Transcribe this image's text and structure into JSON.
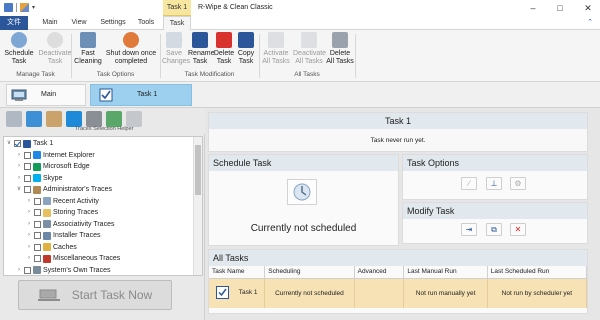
{
  "window": {
    "title": "R-Wipe & Clean Classic",
    "context_group": "Task 1",
    "controls": {
      "minimize": "–",
      "maximize": "□",
      "close": "✕"
    }
  },
  "tabs": [
    "文件",
    "Main",
    "View",
    "Settings",
    "Tools",
    "Task"
  ],
  "ribbon": {
    "buttons": [
      {
        "label1": "Schedule",
        "label2": "Task",
        "icon": "clock-icon",
        "disabled": false
      },
      {
        "label1": "Deactivate",
        "label2": "Task",
        "icon": "clock-off-icon",
        "disabled": true
      },
      {
        "label1": "Fast",
        "label2": "Cleaning",
        "icon": "broom-icon",
        "disabled": false
      },
      {
        "label1": "Shut down once",
        "label2": "completed",
        "icon": "power-icon",
        "disabled": false
      },
      {
        "label1": "Save",
        "label2": "Changes",
        "icon": "save-icon",
        "disabled": true
      },
      {
        "label1": "Rename",
        "label2": "Task",
        "icon": "rename-icon",
        "disabled": false
      },
      {
        "label1": "Delete",
        "label2": "Task",
        "icon": "delete-icon",
        "disabled": false
      },
      {
        "label1": "Copy",
        "label2": "Task",
        "icon": "copy-icon",
        "disabled": false
      },
      {
        "label1": "Activate",
        "label2": "All Tasks",
        "icon": "clipboard-icon",
        "disabled": true
      },
      {
        "label1": "Deactivate",
        "label2": "All Tasks",
        "icon": "clipboard-icon",
        "disabled": true
      },
      {
        "label1": "Delete",
        "label2": "All Tasks",
        "icon": "clipboard-delete-icon",
        "disabled": false
      }
    ],
    "groups": [
      "Manage Task",
      "Task Options",
      "Task Modification",
      "All Tasks"
    ]
  },
  "modebar": {
    "main_label": "Main",
    "task_label": "Task 1"
  },
  "left": {
    "helper_label": "Traces Selection Helper",
    "tree": [
      {
        "label": "Task 1",
        "level": 0,
        "expanded": true,
        "checked": true,
        "icon": "task-icon"
      },
      {
        "label": "Internet  Explorer",
        "level": 1,
        "expanded": false,
        "checked": false,
        "icon": "ie-icon"
      },
      {
        "label": "Microsoft Edge",
        "level": 1,
        "expanded": false,
        "checked": false,
        "icon": "edge-icon"
      },
      {
        "label": "Skype",
        "level": 1,
        "expanded": false,
        "checked": false,
        "icon": "skype-icon"
      },
      {
        "label": "Administrator's Traces",
        "level": 1,
        "expanded": true,
        "checked": false,
        "icon": "user-icon"
      },
      {
        "label": "Recent Activity",
        "level": 2,
        "expanded": false,
        "checked": false,
        "icon": "clock-icon"
      },
      {
        "label": "Storing Traces",
        "level": 2,
        "expanded": false,
        "checked": false,
        "icon": "folder-icon"
      },
      {
        "label": "Associativity Traces",
        "level": 2,
        "expanded": false,
        "checked": false,
        "icon": "assoc-icon"
      },
      {
        "label": "Installer Traces",
        "level": 2,
        "expanded": false,
        "checked": false,
        "icon": "installer-icon"
      },
      {
        "label": "Caches",
        "level": 2,
        "expanded": false,
        "checked": false,
        "icon": "cache-icon"
      },
      {
        "label": "Miscellaneous Traces",
        "level": 2,
        "expanded": false,
        "checked": false,
        "icon": "misc-icon"
      },
      {
        "label": "System's Own Traces",
        "level": 1,
        "expanded": false,
        "checked": false,
        "icon": "system-icon"
      }
    ],
    "start_button": "Start Task Now"
  },
  "task": {
    "title": "Task 1",
    "status": "Task never run yet.",
    "schedule_header": "Schedule Task",
    "schedule_status": "Currently not scheduled",
    "options_header": "Task Options",
    "modify_header": "Modify Task",
    "all_tasks_header": "All Tasks",
    "table": {
      "columns": [
        "Task Name",
        "Scheduling",
        "Advanced",
        "Last Manual Run",
        "Last Scheduled Run"
      ],
      "rows": [
        {
          "name": "Task 1",
          "scheduling": "Currently not scheduled",
          "advanced": "",
          "last_manual": "Not run manually yet",
          "last_scheduled": "Not run by scheduler yet"
        }
      ]
    }
  },
  "colors": {
    "accent": "#2b579a",
    "selected_tab": "#9dd0ef",
    "row_highlight": "#f6e2b4",
    "panel_header": "#e1e8ee"
  }
}
